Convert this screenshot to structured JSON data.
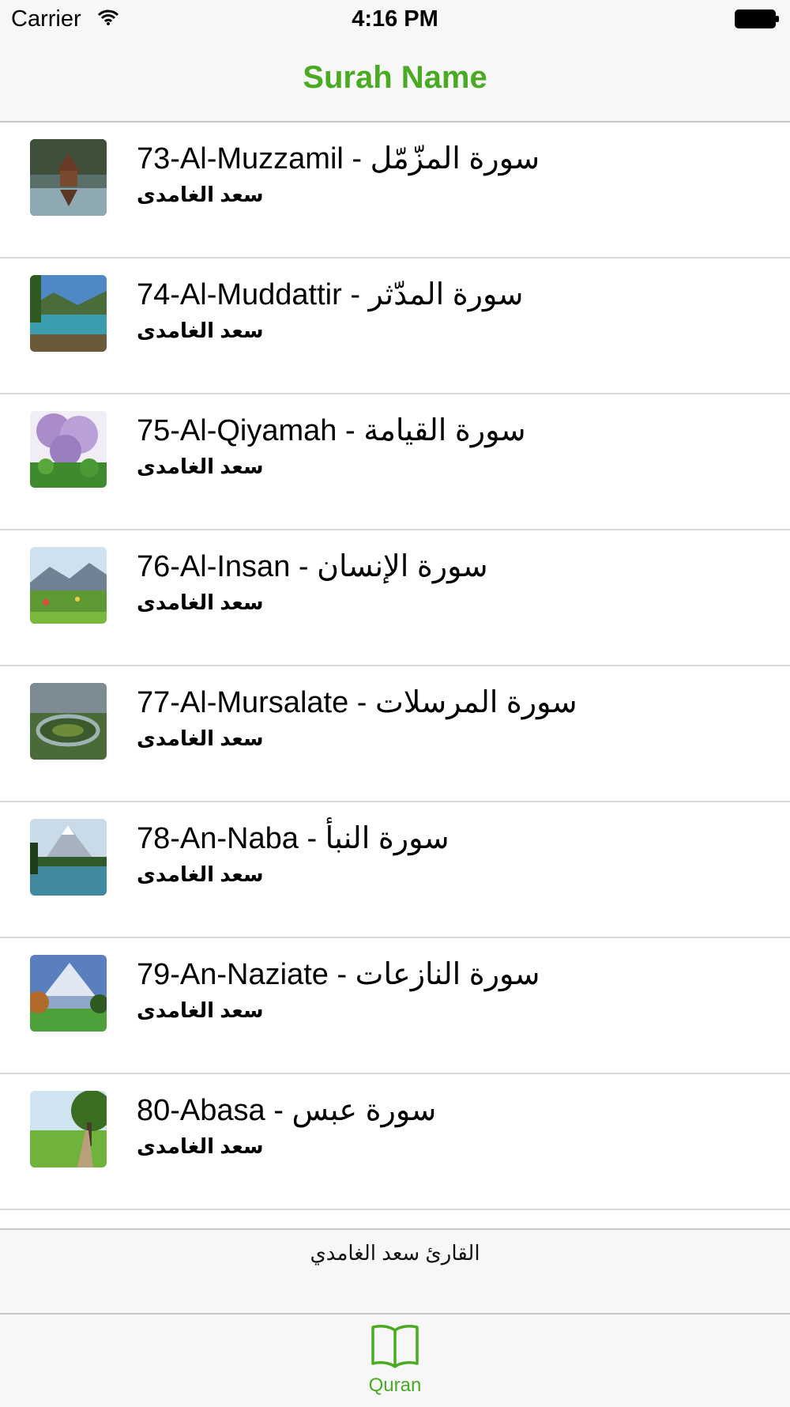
{
  "status_bar": {
    "carrier": "Carrier",
    "time": "4:16 PM"
  },
  "nav": {
    "title": "Surah Name"
  },
  "surahs": [
    {
      "title": "73-Al-Muzzamil - سورة المزّمّل",
      "reciter": "سعد الغامدى"
    },
    {
      "title": "74-Al-Muddattir - سورة المدّثر",
      "reciter": "سعد الغامدى"
    },
    {
      "title": "75-Al-Qiyamah - سورة القيامة",
      "reciter": "سعد الغامدى"
    },
    {
      "title": "76-Al-Insan - سورة الإنسان",
      "reciter": "سعد الغامدى"
    },
    {
      "title": "77-Al-Mursalate - سورة المرسلات",
      "reciter": "سعد الغامدى"
    },
    {
      "title": "78-An-Naba - سورة النبأ",
      "reciter": "سعد الغامدى"
    },
    {
      "title": "79-An-Naziate - سورة النازعات",
      "reciter": "سعد الغامدى"
    },
    {
      "title": "80-Abasa -  سورة عبس",
      "reciter": "سعد الغامدى"
    }
  ],
  "footer": {
    "text": "القارئ سعد الغامدي"
  },
  "tab_bar": {
    "tabs": [
      {
        "label": "Quran",
        "icon": "book-icon",
        "selected": true
      }
    ]
  },
  "colors": {
    "accent": "#4aaa22",
    "bar_background": "#f7f7f7",
    "separator": "#d9d9dc"
  }
}
